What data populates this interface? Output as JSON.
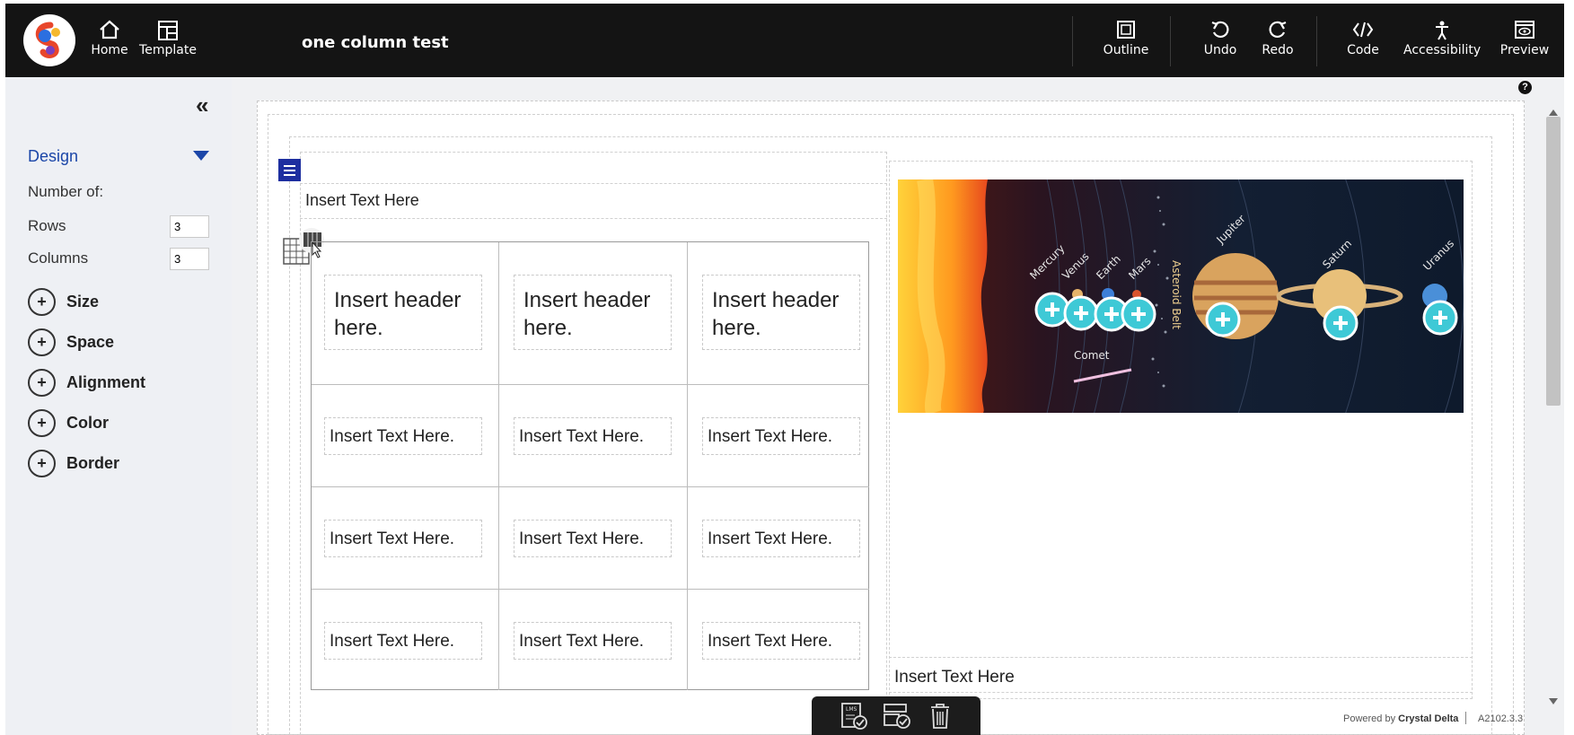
{
  "header": {
    "doc_title": "one column test",
    "home_label": "Home",
    "template_label": "Template",
    "outline_label": "Outline",
    "undo_label": "Undo",
    "redo_label": "Redo",
    "code_label": "Code",
    "accessibility_label": "Accessibility",
    "preview_label": "Preview"
  },
  "sidebar": {
    "collapse_icon": "double-chevron-left-icon",
    "design_label": "Design",
    "number_of_label": "Number of:",
    "rows_label": "Rows",
    "rows_value": "3",
    "columns_label": "Columns",
    "columns_value": "3",
    "sections": [
      {
        "label": "Size"
      },
      {
        "label": "Space"
      },
      {
        "label": "Alignment"
      },
      {
        "label": "Color"
      },
      {
        "label": "Border"
      }
    ]
  },
  "canvas": {
    "top_text": "Insert Text Here",
    "table_headers": [
      "Insert header here.",
      "Insert header here.",
      "Insert header here."
    ],
    "table_rows": [
      [
        "Insert Text Here.",
        "Insert Text Here.",
        "Insert Text Here."
      ],
      [
        "Insert Text Here.",
        "Insert Text Here.",
        "Insert Text Here."
      ],
      [
        "Insert Text Here.",
        "Insert Text Here.",
        "Insert Text Here."
      ]
    ],
    "image": {
      "planet_labels": [
        "Mercury",
        "Venus",
        "Earth",
        "Mars",
        "Asteroid Belt",
        "Jupiter",
        "Saturn",
        "Uranus",
        "Comet"
      ]
    },
    "right_text": "Insert Text Here"
  },
  "footer": {
    "powered_prefix": "Powered by",
    "powered_brand": "Crystal Delta",
    "version": "A2102.3.3",
    "bottom_tools": [
      "lms-check-icon",
      "layout-check-icon",
      "trash-icon"
    ]
  },
  "colors": {
    "accent": "#1b46a8",
    "topbar": "#141414",
    "hotspot": "#3ec9d6"
  }
}
